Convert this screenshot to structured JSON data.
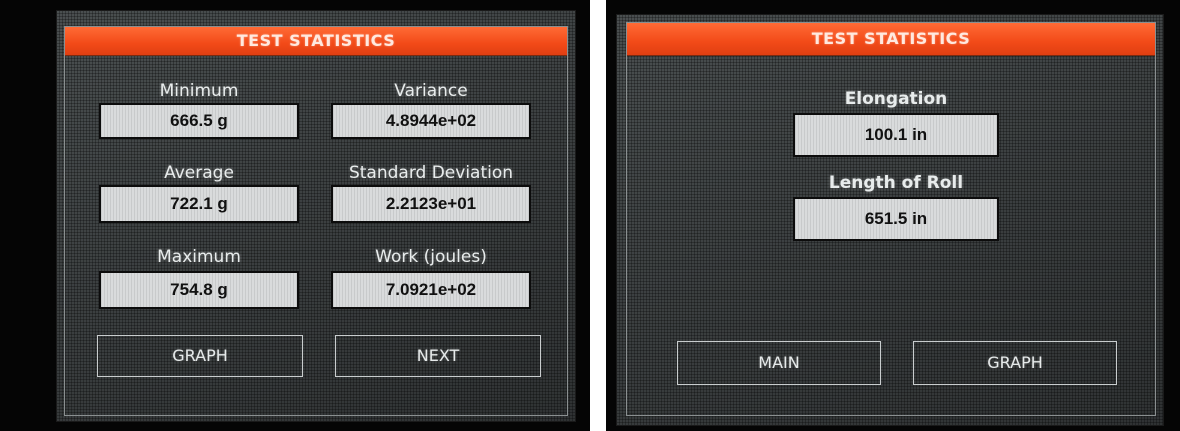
{
  "left_screen": {
    "title": "TEST STATISTICS",
    "fields": [
      {
        "label": "Minimum",
        "value": "666.5 g"
      },
      {
        "label": "Variance",
        "value": "4.8944e+02"
      },
      {
        "label": "Average",
        "value": "722.1 g"
      },
      {
        "label": "Standard Deviation",
        "value": "2.2123e+01"
      },
      {
        "label": "Maximum",
        "value": "754.8 g"
      },
      {
        "label": "Work (joules)",
        "value": "7.0921e+02"
      }
    ],
    "buttons": {
      "graph": "GRAPH",
      "next": "NEXT"
    }
  },
  "right_screen": {
    "title": "TEST STATISTICS",
    "fields": [
      {
        "label": "Elongation",
        "value": "100.1 in"
      },
      {
        "label": "Length of Roll",
        "value": "651.5 in"
      }
    ],
    "buttons": {
      "main": "MAIN",
      "graph": "GRAPH"
    }
  },
  "colors": {
    "title_bar": "#f24a18",
    "screen_bg": "#3b3f40",
    "value_box": "#d9dbdc"
  }
}
